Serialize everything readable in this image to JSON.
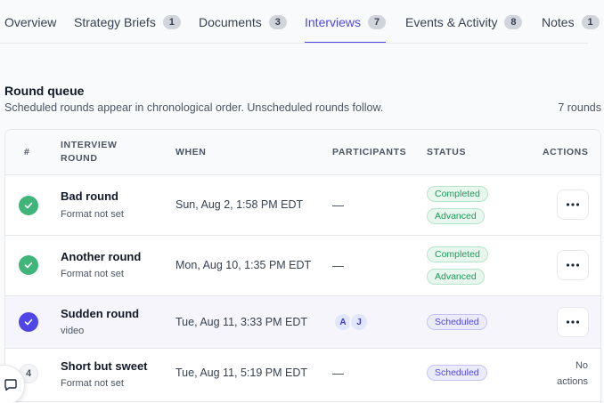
{
  "tabs": [
    {
      "label": "Overview",
      "badge": null
    },
    {
      "label": "Strategy Briefs",
      "badge": "1"
    },
    {
      "label": "Documents",
      "badge": "3"
    },
    {
      "label": "Interviews",
      "badge": "7",
      "active": true
    },
    {
      "label": "Events & Activity",
      "badge": "8"
    },
    {
      "label": "Notes",
      "badge": "1"
    }
  ],
  "section": {
    "title": "Round queue",
    "subtitle": "Scheduled rounds appear in chronological order. Unscheduled rounds follow.",
    "count": "7 rounds"
  },
  "table": {
    "headers": {
      "num": "#",
      "round": "INTERVIEW ROUND",
      "when": "WHEN",
      "participants": "PARTICIPANTS",
      "status": "STATUS",
      "actions": "ACTIONS"
    },
    "rows": [
      {
        "indicator": "check",
        "name": "Bad round",
        "format": "Format not set",
        "when": "Sun, Aug 2, 1:58 PM EDT",
        "participants_empty": "—",
        "badges": [
          "Completed",
          "Advanced"
        ]
      },
      {
        "indicator": "check",
        "name": "Another round",
        "format": "Format not set",
        "when": "Mon, Aug 10, 1:35 PM EDT",
        "participants_empty": "—",
        "badges": [
          "Completed",
          "Advanced"
        ]
      },
      {
        "indicator": "current",
        "name": "Sudden round",
        "format": "video",
        "when": "Tue, Aug 11, 3:33 PM EDT",
        "participants": [
          "A",
          "J"
        ],
        "badges": [
          "Scheduled"
        ]
      },
      {
        "indicator": "4",
        "name": "Short but sweet",
        "format": "Format not set",
        "when": "Tue, Aug 11, 5:19 PM EDT",
        "participants_empty": "—",
        "badges": [
          "Scheduled"
        ],
        "no_actions_line1": "No",
        "no_actions_line2": "actions"
      }
    ]
  },
  "colors": {
    "accent": "#4f46e5",
    "success": "#3fb57a"
  },
  "icons": {
    "more": "ellipsis-icon",
    "check": "check-icon",
    "chat": "chat-icon"
  }
}
